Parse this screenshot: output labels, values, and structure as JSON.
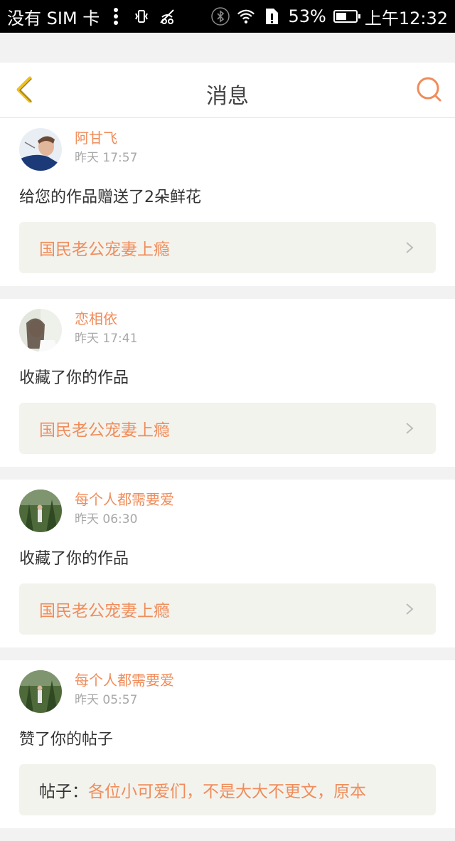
{
  "status": {
    "carrier": "没有 SIM 卡",
    "battery": "53%",
    "battery_level": 0.53,
    "time": "上午12:32"
  },
  "header": {
    "title": "消息"
  },
  "colors": {
    "accent": "#f08c5a",
    "back_arrow": "#f0c020"
  },
  "messages": [
    {
      "name": "阿甘飞",
      "time": "昨天 17:57",
      "action": "给您的作品赠送了2朵鲜花",
      "work": "国民老公宠妻上瘾",
      "avatar_icon": "avatar-man-icon"
    },
    {
      "name": "恋相依",
      "time": "昨天 17:41",
      "action": "收藏了你的作品",
      "work": "国民老公宠妻上瘾",
      "avatar_icon": "avatar-woman-icon"
    },
    {
      "name": "每个人都需要爱",
      "time": "昨天 06:30",
      "action": "收藏了你的作品",
      "work": "国民老公宠妻上瘾",
      "avatar_icon": "avatar-forest-icon"
    },
    {
      "name": "每个人都需要爱",
      "time": "昨天 05:57",
      "action": "赞了你的帖子",
      "work_prefix": "帖子：",
      "work": "各位小可爱们，不是大大不更文，原本",
      "avatar_icon": "avatar-forest-icon"
    }
  ]
}
